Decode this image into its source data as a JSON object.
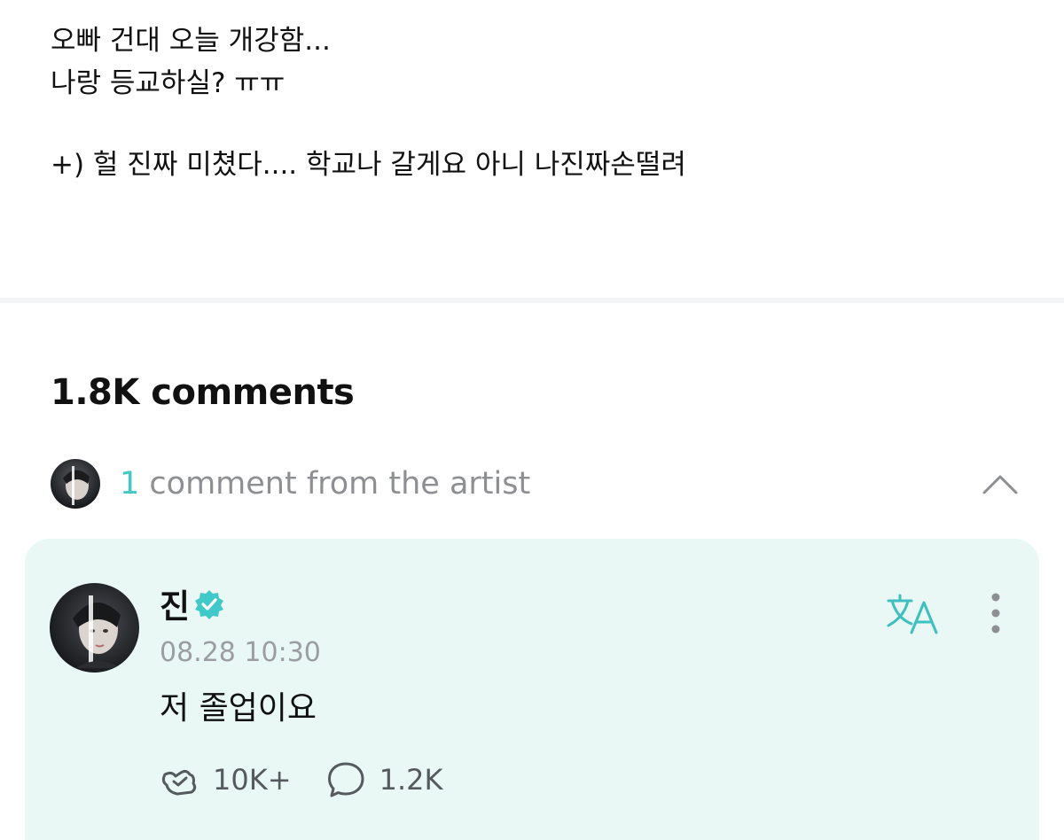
{
  "post": {
    "lines": [
      "오빠 건대 오늘 개강함...",
      "나랑 등교하실? ㅠㅠ",
      "",
      "+) 헐 진짜 미쳤다.... 학교나 갈게요 아니 나진짜손떨려"
    ]
  },
  "comments": {
    "count_label": "1.8K comments",
    "artist_summary": {
      "count": "1",
      "label": " comment from the artist",
      "toggle_icon": "chevron-up-icon"
    },
    "artist_comment": {
      "author": "진",
      "verified_icon": "verified-badge-icon",
      "timestamp": "08.28 10:30",
      "text": "저 졸업이요",
      "likes": "10K+",
      "replies": "1.2K",
      "like_icon": "like-icon",
      "reply_icon": "reply-icon",
      "translate_icon": "translate-icon",
      "more_icon": "more-icon"
    }
  },
  "colors": {
    "accent": "#41c8c8",
    "card_background": "#e9f8f5",
    "muted_text": "#8d8f93"
  }
}
